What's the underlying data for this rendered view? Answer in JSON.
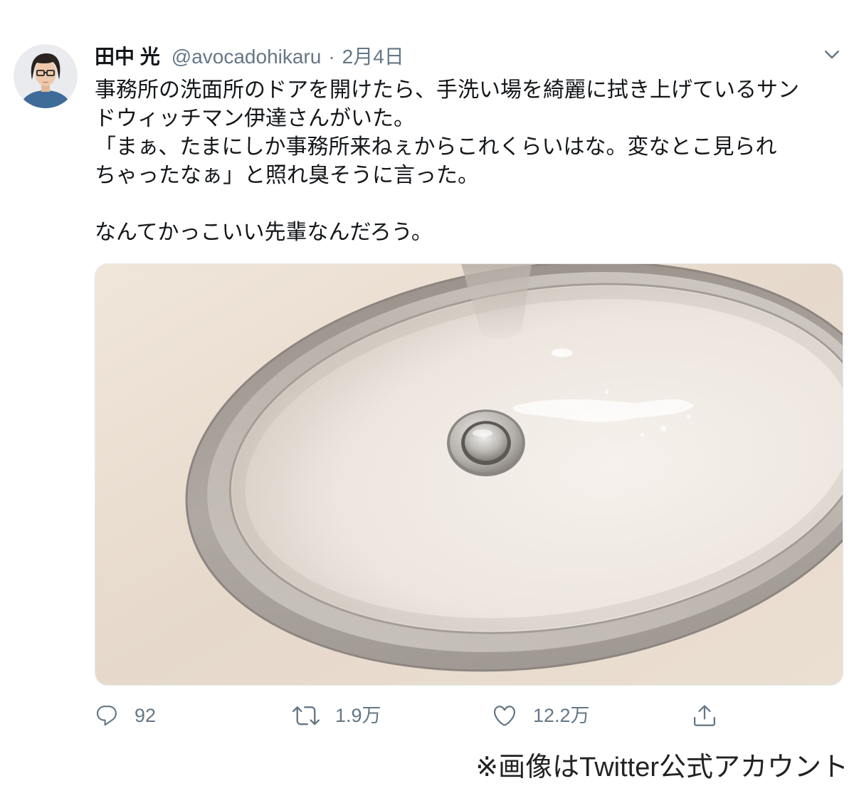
{
  "tweet": {
    "author_name": "田中 光",
    "handle": "@avocadohikaru",
    "separator": "·",
    "date": "2月4日",
    "text_lines": [
      "事務所の洗面所のドアを開けたら、手洗い場を綺麗に拭き上げているサン",
      "ドウィッチマン伊達さんがいた。",
      "「まぁ、たまにしか事務所来ねぇからこれくらいはな。変なとこ見られ",
      "ちゃったなぁ」と照れ臭そうに言った。",
      "なんてかっこいい先輩なんだろう。"
    ]
  },
  "header_menu": {
    "icon": "chevron-down-icon"
  },
  "actions": {
    "reply": {
      "icon": "reply-icon",
      "count": "92"
    },
    "retweet": {
      "icon": "retweet-icon",
      "count": "1.9万"
    },
    "like": {
      "icon": "like-icon",
      "count": "12.2万"
    },
    "share": {
      "icon": "share-icon"
    }
  },
  "caption": "※画像はTwitter公式アカウント",
  "colors": {
    "text": "#14171a",
    "secondary": "#657786",
    "background": "#ffffff",
    "caption": "#222222"
  }
}
